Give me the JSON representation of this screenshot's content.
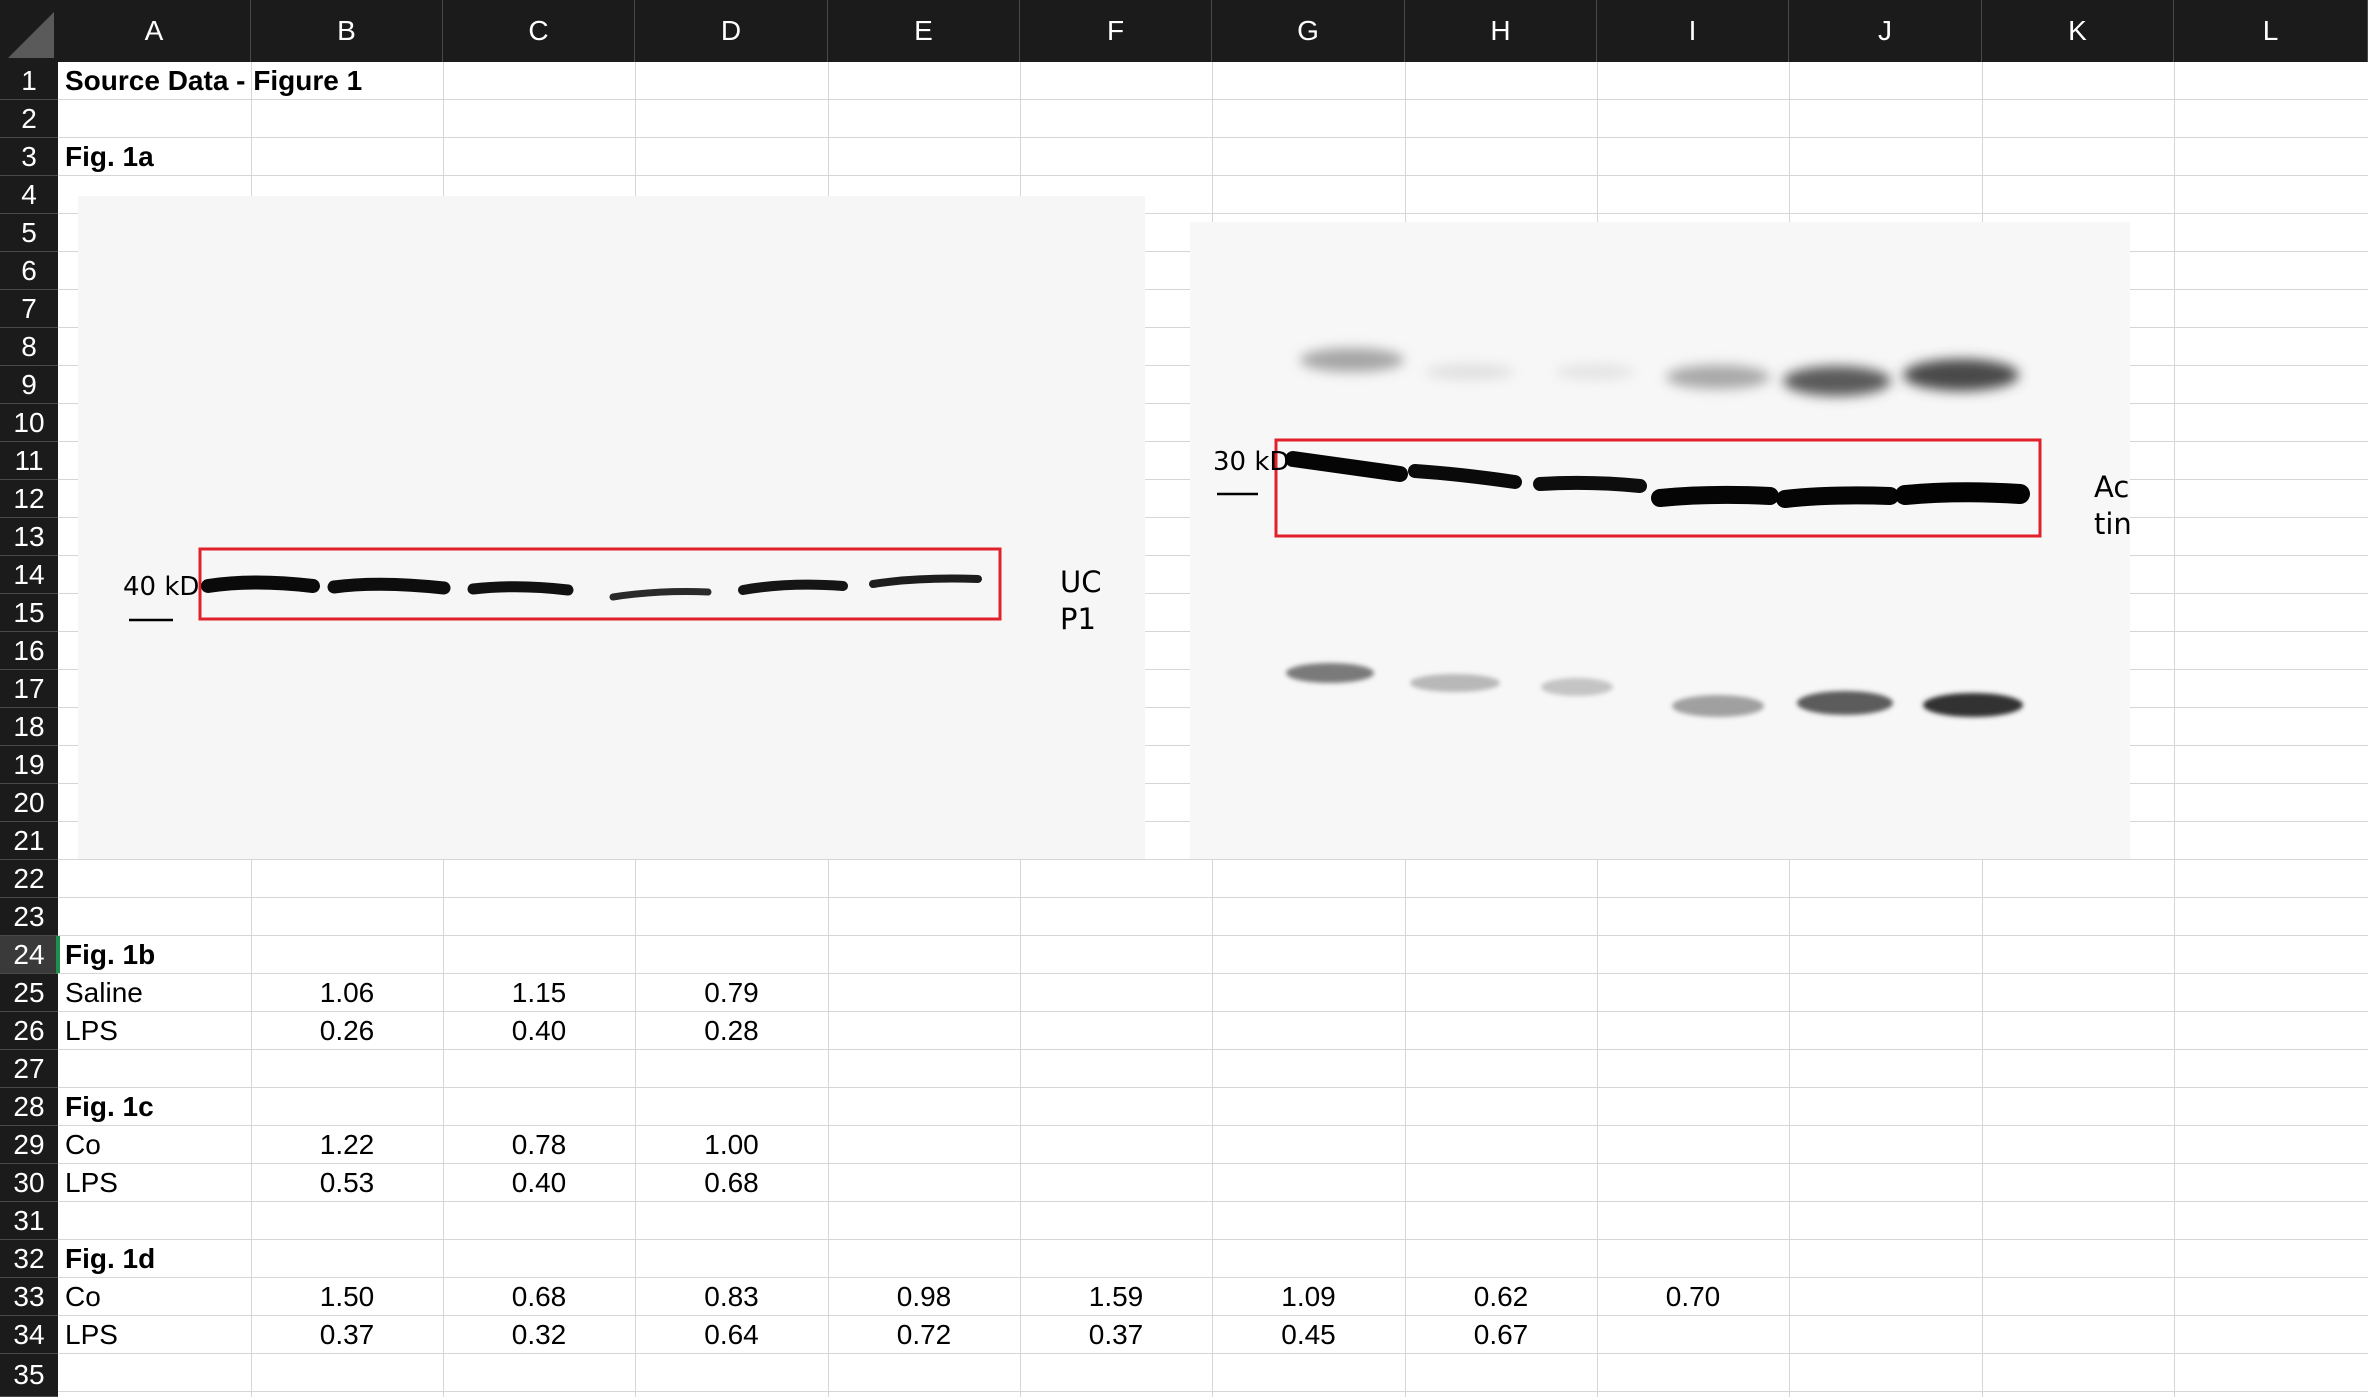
{
  "columns": [
    "A",
    "B",
    "C",
    "D",
    "E",
    "F",
    "G",
    "H",
    "I",
    "J",
    "K",
    "L"
  ],
  "rows": [
    "1",
    "2",
    "3",
    "4",
    "5",
    "6",
    "7",
    "8",
    "9",
    "10",
    "11",
    "12",
    "13",
    "14",
    "15",
    "16",
    "17",
    "18",
    "19",
    "20",
    "21",
    "22",
    "23",
    "24",
    "25",
    "26",
    "27",
    "28",
    "29",
    "30",
    "31",
    "32",
    "33",
    "34",
    "35"
  ],
  "active_row": "24",
  "cells": {
    "a1": "Source Data - Figure 1",
    "a3": "Fig. 1a",
    "a24": "Fig. 1b",
    "a25": "Saline",
    "b25": "1.06",
    "c25": "1.15",
    "d25": "0.79",
    "a26": "LPS",
    "b26": "0.26",
    "c26": "0.40",
    "d26": "0.28",
    "a28": "Fig. 1c",
    "a29": "Co",
    "b29": "1.22",
    "c29": "0.78",
    "d29": "1.00",
    "a30": "LPS",
    "b30": "0.53",
    "c30": "0.40",
    "d30": "0.68",
    "a32": "Fig. 1d",
    "a33": "Co",
    "b33": "1.50",
    "c33": "0.68",
    "d33": "0.83",
    "e33": "0.98",
    "f33": "1.59",
    "g33": "1.09",
    "h33": "0.62",
    "i33": "0.70",
    "a34": "LPS",
    "b34": "0.37",
    "c34": "0.32",
    "d34": "0.64",
    "e34": "0.72",
    "f34": "0.37",
    "g34": "0.45",
    "h34": "0.67"
  },
  "blot_left": {
    "marker": "40 kD",
    "label_line1": "UC",
    "label_line2": "P1"
  },
  "blot_right": {
    "marker": "30 kD",
    "label_line1": "Ac",
    "label_line2": "tin"
  },
  "colors": {
    "header_bg": "#1b1b1b",
    "header_text": "#ffffff",
    "grid": "#d6d6d6",
    "highlight_box": "#e0202a",
    "active_row_accent": "#1f8f4e"
  }
}
